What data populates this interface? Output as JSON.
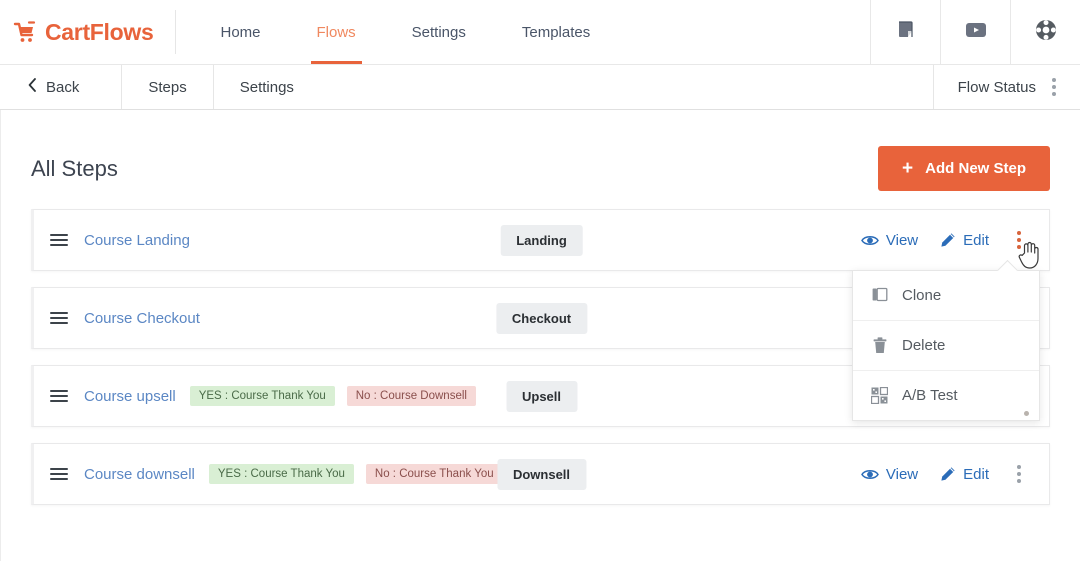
{
  "header": {
    "brand": "CartFlows",
    "brand_icon": "cart-icon",
    "nav": [
      {
        "label": "Home",
        "active": false
      },
      {
        "label": "Flows",
        "active": true
      },
      {
        "label": "Settings",
        "active": false
      },
      {
        "label": "Templates",
        "active": false
      }
    ],
    "icons": [
      {
        "name": "docs-book-icon"
      },
      {
        "name": "video-play-icon"
      },
      {
        "name": "support-wheel-icon"
      }
    ],
    "accent_color": "#e8633b"
  },
  "subheader": {
    "back_label": "Back",
    "back_icon": "chevron-left-icon",
    "tabs": [
      {
        "label": "Steps"
      },
      {
        "label": "Settings"
      }
    ],
    "flow_status_label": "Flow Status",
    "flow_status_menu_icon": "three-dots-vertical-icon"
  },
  "main": {
    "page_title": "All Steps",
    "add_button": {
      "label": "Add New Step",
      "icon": "plus-icon"
    },
    "action_labels": {
      "view": "View",
      "edit": "Edit"
    },
    "action_icons": {
      "view": "eye-icon",
      "edit": "pencil-icon",
      "menu": "three-dots-vertical-icon"
    },
    "steps": [
      {
        "name": "Course Landing",
        "type": "Landing",
        "conditions": [],
        "show_actions": true,
        "menu_active": true
      },
      {
        "name": "Course Checkout",
        "type": "Checkout",
        "conditions": [],
        "show_actions": false,
        "menu_active": false
      },
      {
        "name": "Course upsell",
        "type": "Upsell",
        "conditions": [
          {
            "kind": "yes",
            "label": "YES : Course Thank You"
          },
          {
            "kind": "no",
            "label": "No : Course Downsell"
          }
        ],
        "show_actions": false,
        "menu_active": false
      },
      {
        "name": "Course downsell",
        "type": "Downsell",
        "conditions": [
          {
            "kind": "yes",
            "label": "YES : Course Thank You"
          },
          {
            "kind": "no",
            "label": "No : Course Thank You"
          }
        ],
        "show_actions": true,
        "menu_active": false
      }
    ]
  },
  "dropdown": {
    "open": true,
    "items": [
      {
        "label": "Clone",
        "icon": "clone-copy-icon"
      },
      {
        "label": "Delete",
        "icon": "trash-icon"
      },
      {
        "label": "A/B Test",
        "icon": "ab-test-grid-icon"
      }
    ]
  },
  "colors": {
    "brand_orange": "#e8633b",
    "link_blue": "#2b6cb8",
    "step_name_blue": "#5b87c4",
    "badge_gray_bg": "#eceef0",
    "badge_yes_bg": "#d9efd4",
    "badge_no_bg": "#f6d9d7"
  }
}
